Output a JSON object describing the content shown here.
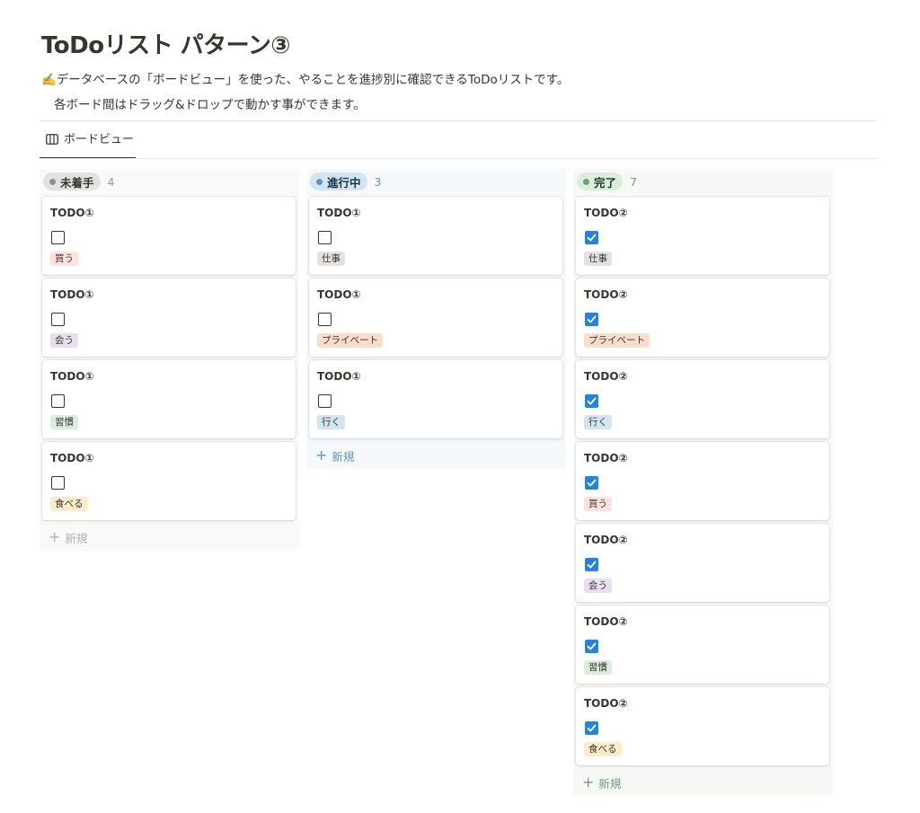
{
  "page": {
    "title": "ToDoリスト パターン③",
    "description_line1": "✍️データベースの「ボードビュー」を使った、やることを進捗別に確認できるToDoリストです。",
    "description_line2": "各ボード間はドラッグ&ドロップで動かす事ができます。"
  },
  "view_tab": {
    "label": "ボードビュー",
    "icon": "board-icon"
  },
  "colors": {
    "tag_kau": "#ffe2dd",
    "tag_au": "#e8deee",
    "tag_shukan": "#dbeddb",
    "tag_taberu": "#fdecc8",
    "tag_shigoto": "#e3e2e0",
    "tag_private": "#fadec9",
    "tag_iku": "#d3e5ef",
    "checkbox_checked": "#2383e2"
  },
  "columns": [
    {
      "name": "未着手",
      "count": "4",
      "bg": "#f9f9f8",
      "pill_bg": "#e3e2e0",
      "dot": "#91918e",
      "text": "#37352f",
      "count_color": "#9b9a97",
      "new_label": "新規",
      "new_color": "#b0afab",
      "cards": [
        {
          "title": "TODO①",
          "checked": false,
          "tag": "買う",
          "tag_bg": "#ffe2dd"
        },
        {
          "title": "TODO①",
          "checked": false,
          "tag": "会う",
          "tag_bg": "#e8deee"
        },
        {
          "title": "TODO①",
          "checked": false,
          "tag": "習慣",
          "tag_bg": "#dbeddb"
        },
        {
          "title": "TODO①",
          "checked": false,
          "tag": "食べる",
          "tag_bg": "#fdecc8"
        }
      ]
    },
    {
      "name": "進行中",
      "count": "3",
      "bg": "#f5f9fc",
      "pill_bg": "#d3e5ef",
      "dot": "#5b97bd",
      "text": "#183347",
      "count_color": "#5b97bd",
      "new_label": "新規",
      "new_color": "#5b97bd",
      "cards": [
        {
          "title": "TODO①",
          "checked": false,
          "tag": "仕事",
          "tag_bg": "#e3e2e0"
        },
        {
          "title": "TODO①",
          "checked": false,
          "tag": "プライベート",
          "tag_bg": "#fadec9"
        },
        {
          "title": "TODO①",
          "checked": false,
          "tag": "行く",
          "tag_bg": "#d3e5ef"
        }
      ]
    },
    {
      "name": "完了",
      "count": "7",
      "bg": "#f6f9f6",
      "pill_bg": "#dbeddb",
      "dot": "#6c9b7d",
      "text": "#1c3829",
      "count_color": "#6c9b7d",
      "new_label": "新規",
      "new_color": "#6c9b7d",
      "cards": [
        {
          "title": "TODO②",
          "checked": true,
          "tag": "仕事",
          "tag_bg": "#e3e2e0"
        },
        {
          "title": "TODO②",
          "checked": true,
          "tag": "プライベート",
          "tag_bg": "#fadec9"
        },
        {
          "title": "TODO②",
          "checked": true,
          "tag": "行く",
          "tag_bg": "#d3e5ef"
        },
        {
          "title": "TODO②",
          "checked": true,
          "tag": "買う",
          "tag_bg": "#ffe2dd"
        },
        {
          "title": "TODO②",
          "checked": true,
          "tag": "会う",
          "tag_bg": "#e8deee"
        },
        {
          "title": "TODO②",
          "checked": true,
          "tag": "習慣",
          "tag_bg": "#dbeddb"
        },
        {
          "title": "TODO②",
          "checked": true,
          "tag": "食べる",
          "tag_bg": "#fdecc8"
        }
      ]
    }
  ]
}
